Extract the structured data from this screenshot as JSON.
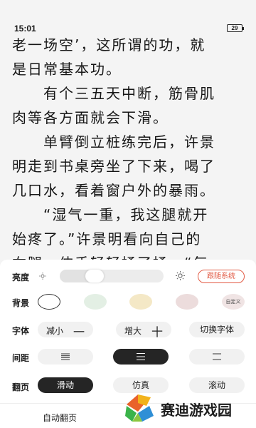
{
  "status_bar": {
    "time": "15:01",
    "battery": "29"
  },
  "reader": {
    "lines": [
      "老一场空’，这所谓的功，就",
      "是日常基本功。",
      "　　有个三五天中断，筋骨肌",
      "肉等各方面就会下滑。",
      "　　单臂倒立桩练完后，许景",
      "明走到书桌旁坐了下来，喝了",
      "几口水，看着窗户外的暴雨。",
      "　　“湿气一重，我这腿就开",
      "始疼了。”许景明看向自己的",
      "右腿，伸手轻轻揉了揉。“每"
    ]
  },
  "settings": {
    "brightness": {
      "label": "亮度",
      "level_percent": 30,
      "follow_system_label": "跟随系统"
    },
    "background": {
      "label": "背景",
      "swatches": [
        "#ffffff",
        "#e3efe4",
        "#f4e8c6",
        "#ecdcdc"
      ],
      "selected_index": 0,
      "custom_label": "自定义"
    },
    "font": {
      "label": "字体",
      "decrease_label": "减小",
      "decrease_symbol": "一",
      "increase_label": "增大",
      "increase_symbol": "十",
      "switch_label": "切换字体"
    },
    "spacing": {
      "label": "间距",
      "options": [
        "compact",
        "medium",
        "loose"
      ],
      "selected_index": 1
    },
    "page_turn": {
      "label": "翻页",
      "options": [
        "滑动",
        "仿真",
        "滚动"
      ],
      "selected_index": 0
    },
    "auto_page_label": "自动翻页"
  },
  "watermark": {
    "text": "赛迪游戏园"
  },
  "colors": {
    "accent": "#e25b45",
    "selected_pill": "#252525",
    "pill": "#f1f1f1"
  }
}
